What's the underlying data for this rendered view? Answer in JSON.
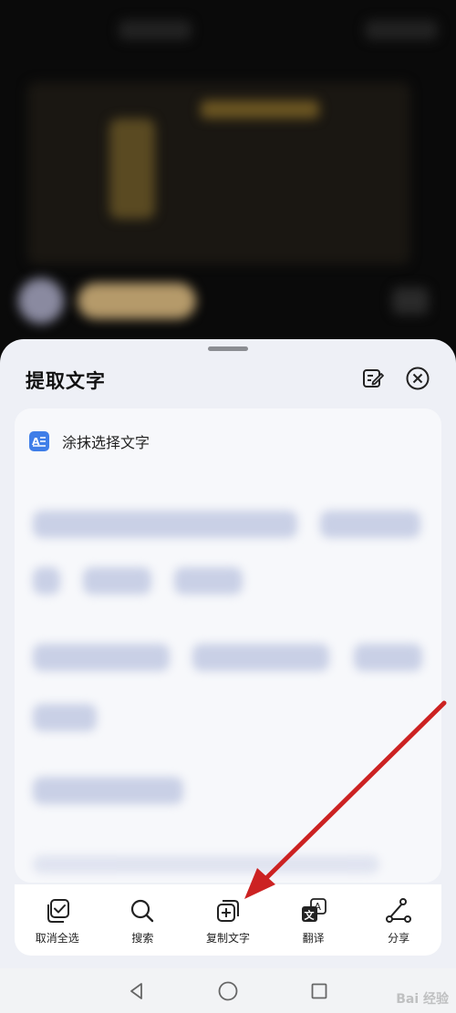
{
  "sheet": {
    "title": "提取文字",
    "edit_icon": "edit-note-icon",
    "close_icon": "close-circle-icon"
  },
  "card": {
    "header_icon": "text-document-icon",
    "header_label": "涂抹选择文字"
  },
  "actions": [
    {
      "icon": "select-all-check-icon",
      "label": "取消全选"
    },
    {
      "icon": "search-icon",
      "label": "搜索"
    },
    {
      "icon": "copy-add-icon",
      "label": "复制文字"
    },
    {
      "icon": "translate-icon",
      "label": "翻译"
    },
    {
      "icon": "share-icon",
      "label": "分享"
    }
  ],
  "nav": {
    "back_icon": "back-triangle-icon",
    "home_icon": "home-circle-icon",
    "recents_icon": "recents-square-icon"
  },
  "annotation": {
    "color": "#cc2222"
  },
  "watermark": "Bai 经验"
}
